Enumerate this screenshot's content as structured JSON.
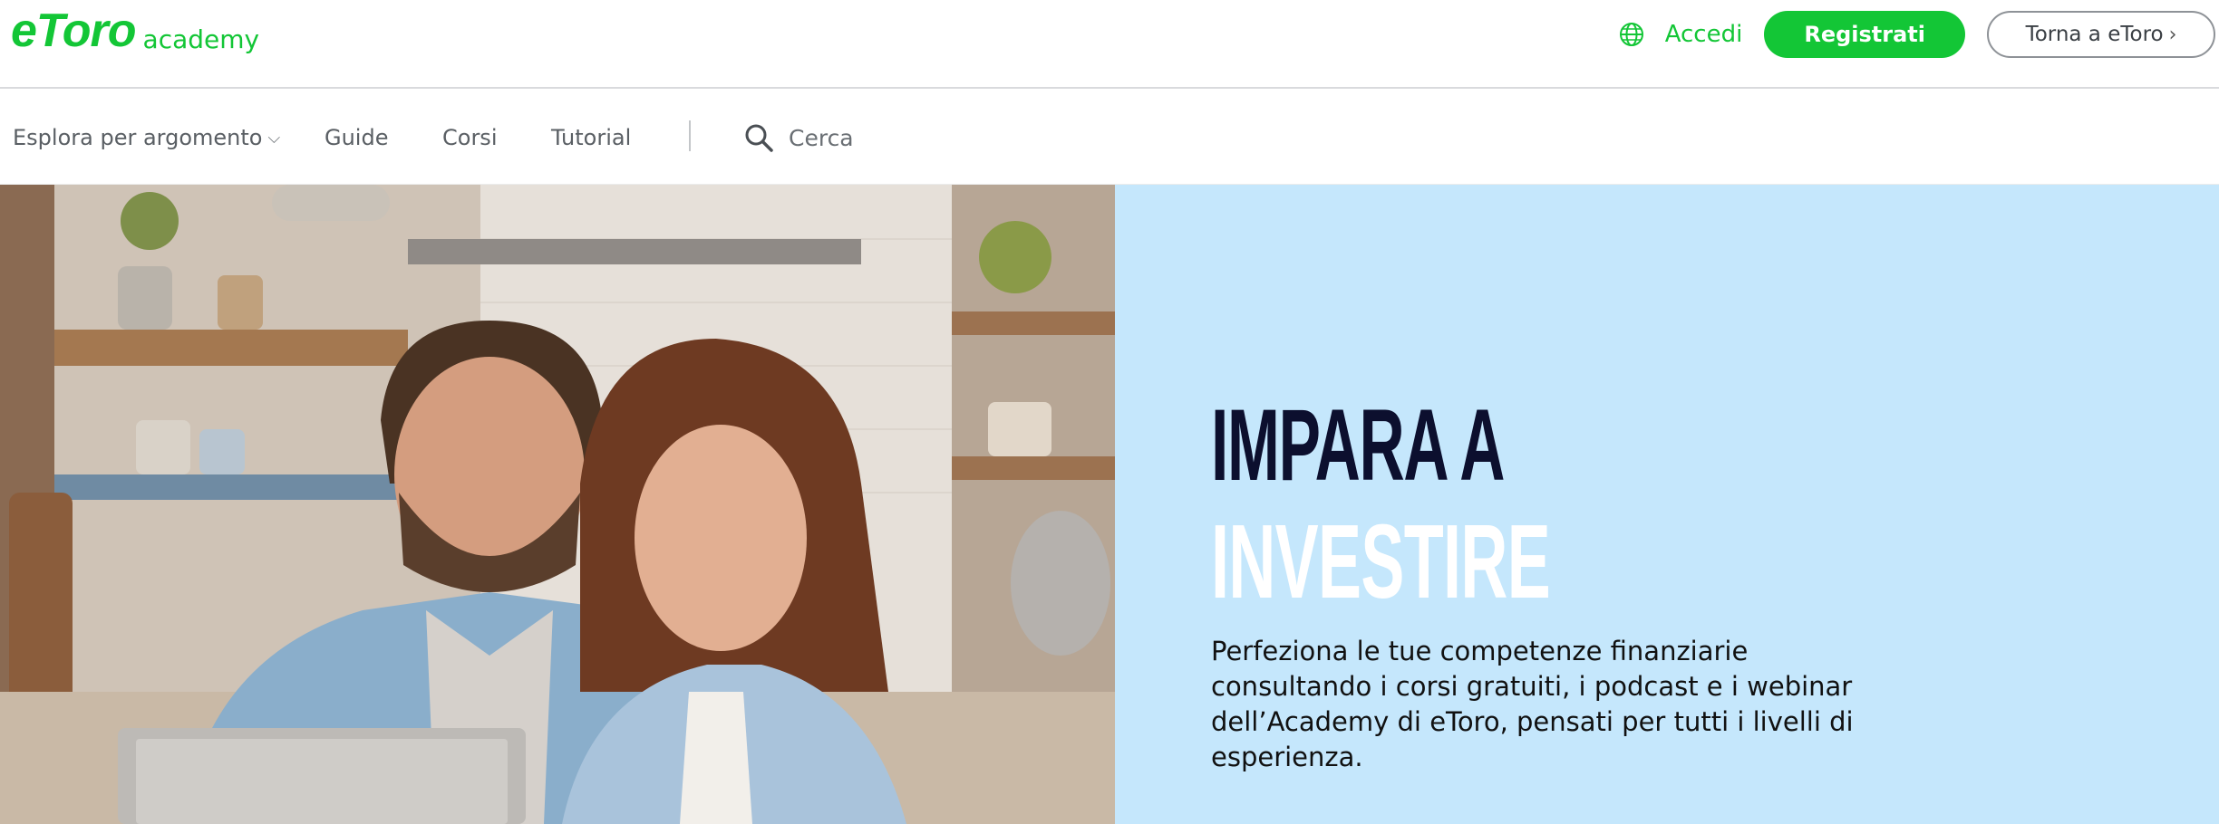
{
  "header": {
    "logo_text": "eToro",
    "logo_subtext": "academy",
    "login_label": "Accedi",
    "register_label": "Registrati",
    "back_label": "Torna a eToro",
    "back_chevron": "›",
    "icons": {
      "language": "globe-icon"
    }
  },
  "nav": {
    "items": [
      {
        "label": "Esplora per argomento",
        "caret": "⌵"
      },
      {
        "label": "Guide"
      },
      {
        "label": "Corsi"
      },
      {
        "label": "Tutorial"
      }
    ],
    "search": {
      "placeholder": "Cerca",
      "icon": "search-icon"
    }
  },
  "hero": {
    "title_line1": "IMPARA A",
    "title_line2": "INVESTIRE",
    "description": "Perfeziona le tue competenze finanziarie consultando i corsi gratuiti, i podcast e i webinar dell’Academy di eToro, pensati per tutti i livelli di esperienza.",
    "image_alt": "Coppia sorridente davanti a un laptop in cucina"
  },
  "colors": {
    "brand_green": "#13c636",
    "hero_panel": "#c5e7fc",
    "title_dark": "#0c0f2e",
    "title_light": "#ffffff"
  }
}
